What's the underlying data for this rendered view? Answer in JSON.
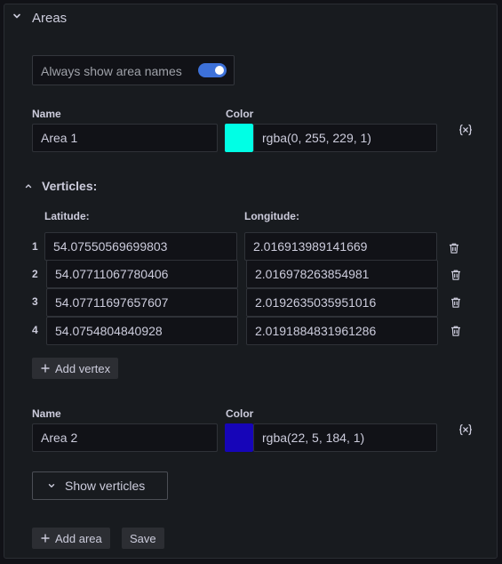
{
  "section": {
    "title": "Areas",
    "icon": "chevron-down-icon"
  },
  "toggle": {
    "label": "Always show area names",
    "on": true,
    "accent": "#3d71d9"
  },
  "labels": {
    "name": "Name",
    "color": "Color",
    "latitude": "Latitude:",
    "longitude": "Longitude:"
  },
  "areas": [
    {
      "name": "Area 1",
      "color_text": "rgba(0, 255, 229, 1)",
      "swatch": "#00ffe5",
      "verticles_title": "Verticles:",
      "vertices": [
        {
          "num": "1",
          "lat": "54.07550569699803",
          "lon": "2.016913989141669"
        },
        {
          "num": "2",
          "lat": "54.07711067780406",
          "lon": "2.016978263854981"
        },
        {
          "num": "3",
          "lat": "54.07711697657607",
          "lon": "2.0192635035951016"
        },
        {
          "num": "4",
          "lat": "54.0754804840928",
          "lon": "2.0191884831961286"
        }
      ],
      "add_vertex_label": "Add vertex"
    },
    {
      "name": "Area 2",
      "color_text": "rgba(22, 5, 184, 1)",
      "swatch": "#1605b8",
      "show_verticles_label": "Show verticles"
    }
  ],
  "footer": {
    "add_area_label": "Add area",
    "save_label": "Save"
  }
}
